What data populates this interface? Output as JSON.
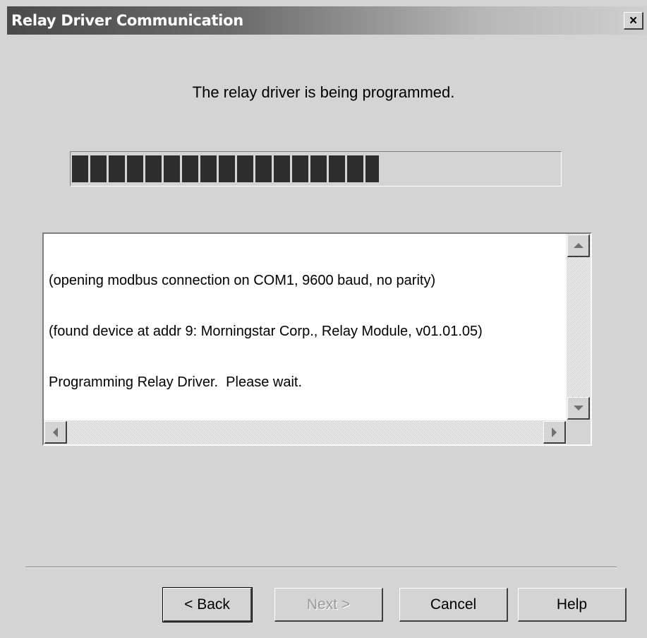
{
  "window": {
    "title": "Relay Driver Communication",
    "close_label": "×"
  },
  "message": "The relay driver is being programmed.",
  "progress": {
    "fraction": 0.63
  },
  "log": {
    "lines": [
      "(opening modbus connection on COM1, 9600 baud, no parity)",
      "(found device at addr 9: Morningstar Corp., Relay Module, v01.01.05)",
      "Programming Relay Driver.  Please wait."
    ]
  },
  "buttons": {
    "back": "< Back",
    "next": "Next >",
    "cancel": "Cancel",
    "help": "Help"
  },
  "icons": {
    "close": "close-icon",
    "scroll_up": "arrow-up-icon",
    "scroll_down": "arrow-down-icon",
    "scroll_left": "arrow-left-icon",
    "scroll_right": "arrow-right-icon"
  },
  "colors": {
    "title_bar_start": "#4a4a4a",
    "title_bar_end": "#cfcfcf",
    "progress_block": "#2d2d2d",
    "dialog_bg": "#d4d4d4"
  }
}
